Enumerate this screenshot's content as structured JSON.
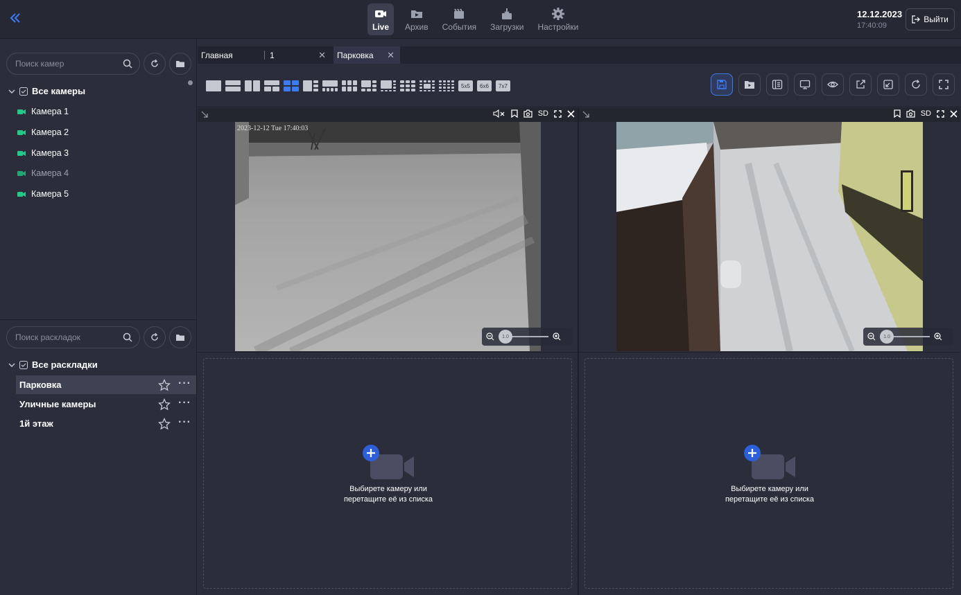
{
  "header": {
    "nav": [
      {
        "label": "Live",
        "icon": "live-camera-icon",
        "active": true
      },
      {
        "label": "Архив",
        "icon": "archive-folder-icon",
        "active": false
      },
      {
        "label": "События",
        "icon": "events-clapper-icon",
        "active": false
      },
      {
        "label": "Загрузки",
        "icon": "downloads-icon",
        "active": false
      },
      {
        "label": "Настройки",
        "icon": "gear-icon",
        "active": false
      }
    ],
    "date": "12.12.2023",
    "time": "17:40:09",
    "logout_label": "Выйти"
  },
  "sidebar": {
    "camera_search_placeholder": "Поиск камер",
    "cameras_root": "Все камеры",
    "cameras": [
      {
        "label": "Камера 1",
        "dim": false
      },
      {
        "label": "Камера 2",
        "dim": false
      },
      {
        "label": "Камера 3",
        "dim": false
      },
      {
        "label": "Камера 4",
        "dim": true
      },
      {
        "label": "Камера 5",
        "dim": false
      }
    ],
    "layout_search_placeholder": "Поиск раскладок",
    "layouts_root": "Все раскладки",
    "layouts": [
      {
        "label": "Парковка",
        "selected": true
      },
      {
        "label": "Уличные камеры",
        "selected": false
      },
      {
        "label": "1й этаж",
        "selected": false
      }
    ]
  },
  "tabs": [
    {
      "label": "Главная",
      "closable": false
    },
    {
      "label": "1",
      "closable": true
    },
    {
      "label": "Парковка",
      "closable": true,
      "active": true
    }
  ],
  "grid_options": [
    "5x5",
    "6x6",
    "7x7"
  ],
  "panes": {
    "quality_label": "SD",
    "zoom_value": "1.0",
    "overlay_timestamp": "2023-12-12 Tue 17:40:03",
    "empty_message_line1": "Выбирете камеру или",
    "empty_message_line2": "перетащите её из списка"
  },
  "colors": {
    "accent": "#3d7bf5",
    "camera_green": "#22c98a",
    "background": "#2b2d3a"
  }
}
